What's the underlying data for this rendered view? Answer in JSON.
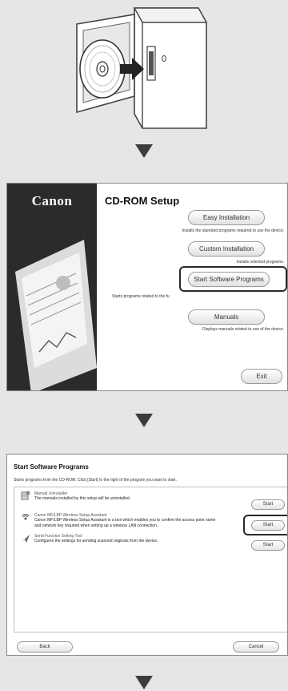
{
  "setup_window": {
    "logo": "Canon",
    "title": "CD-ROM Setup",
    "options": [
      {
        "button": "Easy Installation",
        "description": "Installs the standard programs required to use the device."
      },
      {
        "button": "Custom Installation",
        "description": "Installs selected programs."
      },
      {
        "button": "Start Software Programs",
        "description": "Starts programs related to the fu"
      },
      {
        "button": "Manuals",
        "description": "Displays manuals related to use of the device."
      }
    ],
    "exit_label": "Exit"
  },
  "programs_window": {
    "title": "Start Software Programs",
    "subtitle": "Starts programs from the CD-ROM. Click [Start] to the right of the program you want to start.",
    "programs": [
      {
        "name": "Manual Uninstaller",
        "desc1": "The manuals installed by this setup will be uninstalled.",
        "desc2": "",
        "start": "Start",
        "icon": "uninstaller-icon"
      },
      {
        "name": "Canon MF/LBP Wireless Setup Assistant",
        "desc1": "Canon MF/LBP Wireless Setup Assistant is a tool which enables you to confirm the access point name",
        "desc2": "and network key required when setting up a wireless LAN connection.",
        "start": "Start",
        "icon": "wireless-icon"
      },
      {
        "name": "Send Function Setting Tool",
        "desc1": "Configures the settings for sending scanned originals from the device.",
        "desc2": "",
        "start": "Start",
        "icon": "send-tool-icon"
      }
    ],
    "back_label": "Back",
    "cancel_label": "Cancel"
  }
}
